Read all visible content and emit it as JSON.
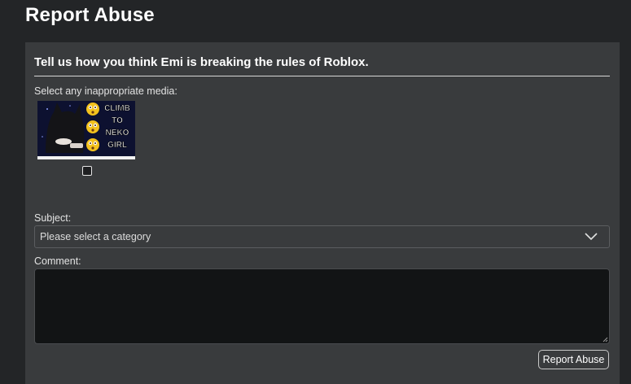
{
  "page": {
    "title": "Report Abuse"
  },
  "form": {
    "heading": "Tell us how you think Emi is breaking the rules of Roblox.",
    "media_label": "Select any inappropriate media:",
    "media": [
      {
        "caption_lines": [
          "CLIMB",
          "TO",
          "NEKO",
          "GIRL"
        ],
        "checked": false
      }
    ],
    "subject_label": "Subject:",
    "subject_value": "Please select a category",
    "comment_label": "Comment:",
    "comment_value": "",
    "submit_label": "Report Abuse"
  },
  "colors": {
    "background": "#232527",
    "panel": "#393b3d",
    "textarea": "#121415",
    "thumbnail_bg": "#0d1130",
    "emoji": "#f3c21d"
  }
}
